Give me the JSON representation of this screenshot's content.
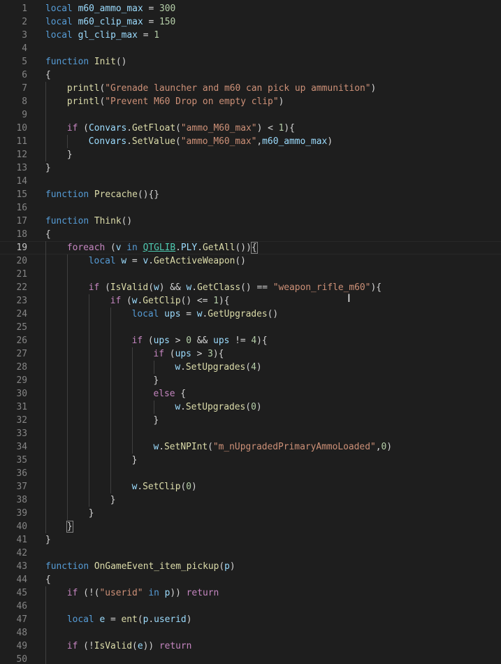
{
  "editor": {
    "colors": {
      "background": "#1e1e1e",
      "keyword": "#569cd6",
      "control": "#c586c0",
      "function": "#dcdcaa",
      "variable": "#9cdcfe",
      "string": "#ce9178",
      "number": "#b5cea8",
      "type": "#4ec9b0",
      "line_number": "#858585"
    },
    "active_line": 19,
    "mouse_cursor_icon": "text-ibeam-icon",
    "mouse_cursor_glyph": "I",
    "lines": [
      {
        "number": "1",
        "indent": 0,
        "tokens": [
          {
            "t": "local",
            "c": "kw"
          },
          {
            "t": " ",
            "c": "plain"
          },
          {
            "t": "m60_ammo_max",
            "c": "var"
          },
          {
            "t": " = ",
            "c": "op"
          },
          {
            "t": "300",
            "c": "num"
          }
        ]
      },
      {
        "number": "2",
        "indent": 0,
        "tokens": [
          {
            "t": "local",
            "c": "kw"
          },
          {
            "t": " ",
            "c": "plain"
          },
          {
            "t": "m60_clip_max",
            "c": "var"
          },
          {
            "t": " = ",
            "c": "op"
          },
          {
            "t": "150",
            "c": "num"
          }
        ]
      },
      {
        "number": "3",
        "indent": 0,
        "tokens": [
          {
            "t": "local",
            "c": "kw"
          },
          {
            "t": " ",
            "c": "plain"
          },
          {
            "t": "gl_clip_max",
            "c": "var"
          },
          {
            "t": " = ",
            "c": "op"
          },
          {
            "t": "1",
            "c": "num"
          }
        ]
      },
      {
        "number": "4",
        "indent": 0,
        "tokens": []
      },
      {
        "number": "5",
        "indent": 0,
        "tokens": [
          {
            "t": "function",
            "c": "kw"
          },
          {
            "t": " ",
            "c": "plain"
          },
          {
            "t": "Init",
            "c": "fn"
          },
          {
            "t": "()",
            "c": "plain"
          }
        ]
      },
      {
        "number": "6",
        "indent": 0,
        "tokens": [
          {
            "t": "{",
            "c": "plain"
          }
        ]
      },
      {
        "number": "7",
        "indent": 1,
        "tokens": [
          {
            "t": "printl",
            "c": "fn"
          },
          {
            "t": "(",
            "c": "plain"
          },
          {
            "t": "\"Grenade launcher and m60 can pick up ammunition\"",
            "c": "str"
          },
          {
            "t": ")",
            "c": "plain"
          }
        ]
      },
      {
        "number": "8",
        "indent": 1,
        "tokens": [
          {
            "t": "printl",
            "c": "fn"
          },
          {
            "t": "(",
            "c": "plain"
          },
          {
            "t": "\"Prevent M60 Drop on empty clip\"",
            "c": "str"
          },
          {
            "t": ")",
            "c": "plain"
          }
        ]
      },
      {
        "number": "9",
        "indent": 1,
        "tokens": []
      },
      {
        "number": "10",
        "indent": 1,
        "tokens": [
          {
            "t": "if",
            "c": "ctrl"
          },
          {
            "t": " (",
            "c": "plain"
          },
          {
            "t": "Convars",
            "c": "var"
          },
          {
            "t": ".",
            "c": "plain"
          },
          {
            "t": "GetFloat",
            "c": "fn"
          },
          {
            "t": "(",
            "c": "plain"
          },
          {
            "t": "\"ammo_M60_max\"",
            "c": "str"
          },
          {
            "t": ") < ",
            "c": "op"
          },
          {
            "t": "1",
            "c": "num"
          },
          {
            "t": "){",
            "c": "plain"
          }
        ]
      },
      {
        "number": "11",
        "indent": 2,
        "tokens": [
          {
            "t": "Convars",
            "c": "var"
          },
          {
            "t": ".",
            "c": "plain"
          },
          {
            "t": "SetValue",
            "c": "fn"
          },
          {
            "t": "(",
            "c": "plain"
          },
          {
            "t": "\"ammo_M60_max\"",
            "c": "str"
          },
          {
            "t": ",",
            "c": "plain"
          },
          {
            "t": "m60_ammo_max",
            "c": "var"
          },
          {
            "t": ")",
            "c": "plain"
          }
        ]
      },
      {
        "number": "12",
        "indent": 1,
        "tokens": [
          {
            "t": "}",
            "c": "plain"
          }
        ]
      },
      {
        "number": "13",
        "indent": 0,
        "tokens": [
          {
            "t": "}",
            "c": "plain"
          }
        ]
      },
      {
        "number": "14",
        "indent": 0,
        "tokens": []
      },
      {
        "number": "15",
        "indent": 0,
        "tokens": [
          {
            "t": "function",
            "c": "kw"
          },
          {
            "t": " ",
            "c": "plain"
          },
          {
            "t": "Precache",
            "c": "fn"
          },
          {
            "t": "(){}",
            "c": "plain"
          }
        ]
      },
      {
        "number": "16",
        "indent": 0,
        "tokens": []
      },
      {
        "number": "17",
        "indent": 0,
        "tokens": [
          {
            "t": "function",
            "c": "kw"
          },
          {
            "t": " ",
            "c": "plain"
          },
          {
            "t": "Think",
            "c": "fn"
          },
          {
            "t": "()",
            "c": "plain"
          }
        ]
      },
      {
        "number": "18",
        "indent": 0,
        "tokens": [
          {
            "t": "{",
            "c": "plain"
          }
        ]
      },
      {
        "number": "19",
        "indent": 1,
        "tokens": [
          {
            "t": "foreach",
            "c": "ctrl"
          },
          {
            "t": " (",
            "c": "plain"
          },
          {
            "t": "v",
            "c": "var"
          },
          {
            "t": " in ",
            "c": "kw"
          },
          {
            "t": "QTGLIB",
            "c": "type",
            "u": true
          },
          {
            "t": ".",
            "c": "plain"
          },
          {
            "t": "PLY",
            "c": "var"
          },
          {
            "t": ".",
            "c": "plain"
          },
          {
            "t": "GetAll",
            "c": "fn"
          },
          {
            "t": "())",
            "c": "plain"
          },
          {
            "t": "{",
            "c": "plain",
            "b": true
          }
        ]
      },
      {
        "number": "20",
        "indent": 2,
        "tokens": [
          {
            "t": "local",
            "c": "kw"
          },
          {
            "t": " ",
            "c": "plain"
          },
          {
            "t": "w",
            "c": "var"
          },
          {
            "t": " = ",
            "c": "op"
          },
          {
            "t": "v",
            "c": "var"
          },
          {
            "t": ".",
            "c": "plain"
          },
          {
            "t": "GetActiveWeapon",
            "c": "fn"
          },
          {
            "t": "()",
            "c": "plain"
          }
        ]
      },
      {
        "number": "21",
        "indent": 2,
        "tokens": []
      },
      {
        "number": "22",
        "indent": 2,
        "tokens": [
          {
            "t": "if",
            "c": "ctrl"
          },
          {
            "t": " (",
            "c": "plain"
          },
          {
            "t": "IsValid",
            "c": "fn"
          },
          {
            "t": "(",
            "c": "plain"
          },
          {
            "t": "w",
            "c": "var"
          },
          {
            "t": ") && ",
            "c": "op"
          },
          {
            "t": "w",
            "c": "var"
          },
          {
            "t": ".",
            "c": "plain"
          },
          {
            "t": "GetClass",
            "c": "fn"
          },
          {
            "t": "() == ",
            "c": "op"
          },
          {
            "t": "\"weapon_rifle_m60\"",
            "c": "str"
          },
          {
            "t": "){",
            "c": "plain"
          }
        ]
      },
      {
        "number": "23",
        "indent": 3,
        "tokens": [
          {
            "t": "if",
            "c": "ctrl"
          },
          {
            "t": " (",
            "c": "plain"
          },
          {
            "t": "w",
            "c": "var"
          },
          {
            "t": ".",
            "c": "plain"
          },
          {
            "t": "GetClip",
            "c": "fn"
          },
          {
            "t": "() <= ",
            "c": "op"
          },
          {
            "t": "1",
            "c": "num"
          },
          {
            "t": "){",
            "c": "plain"
          }
        ]
      },
      {
        "number": "24",
        "indent": 4,
        "tokens": [
          {
            "t": "local",
            "c": "kw"
          },
          {
            "t": " ",
            "c": "plain"
          },
          {
            "t": "ups",
            "c": "var"
          },
          {
            "t": " = ",
            "c": "op"
          },
          {
            "t": "w",
            "c": "var"
          },
          {
            "t": ".",
            "c": "plain"
          },
          {
            "t": "GetUpgrades",
            "c": "fn"
          },
          {
            "t": "()",
            "c": "plain"
          }
        ]
      },
      {
        "number": "25",
        "indent": 4,
        "tokens": []
      },
      {
        "number": "26",
        "indent": 4,
        "tokens": [
          {
            "t": "if",
            "c": "ctrl"
          },
          {
            "t": " (",
            "c": "plain"
          },
          {
            "t": "ups",
            "c": "var"
          },
          {
            "t": " > ",
            "c": "op"
          },
          {
            "t": "0",
            "c": "num"
          },
          {
            "t": " && ",
            "c": "op"
          },
          {
            "t": "ups",
            "c": "var"
          },
          {
            "t": " != ",
            "c": "op"
          },
          {
            "t": "4",
            "c": "num"
          },
          {
            "t": "){",
            "c": "plain"
          }
        ]
      },
      {
        "number": "27",
        "indent": 5,
        "tokens": [
          {
            "t": "if",
            "c": "ctrl"
          },
          {
            "t": " (",
            "c": "plain"
          },
          {
            "t": "ups",
            "c": "var"
          },
          {
            "t": " > ",
            "c": "op"
          },
          {
            "t": "3",
            "c": "num"
          },
          {
            "t": "){",
            "c": "plain"
          }
        ]
      },
      {
        "number": "28",
        "indent": 6,
        "tokens": [
          {
            "t": "w",
            "c": "var"
          },
          {
            "t": ".",
            "c": "plain"
          },
          {
            "t": "SetUpgrades",
            "c": "fn"
          },
          {
            "t": "(",
            "c": "plain"
          },
          {
            "t": "4",
            "c": "num"
          },
          {
            "t": ")",
            "c": "plain"
          }
        ]
      },
      {
        "number": "29",
        "indent": 5,
        "tokens": [
          {
            "t": "}",
            "c": "plain"
          }
        ]
      },
      {
        "number": "30",
        "indent": 5,
        "tokens": [
          {
            "t": "else",
            "c": "ctrl"
          },
          {
            "t": " {",
            "c": "plain"
          }
        ]
      },
      {
        "number": "31",
        "indent": 6,
        "tokens": [
          {
            "t": "w",
            "c": "var"
          },
          {
            "t": ".",
            "c": "plain"
          },
          {
            "t": "SetUpgrades",
            "c": "fn"
          },
          {
            "t": "(",
            "c": "plain"
          },
          {
            "t": "0",
            "c": "num"
          },
          {
            "t": ")",
            "c": "plain"
          }
        ]
      },
      {
        "number": "32",
        "indent": 5,
        "tokens": [
          {
            "t": "}",
            "c": "plain"
          }
        ]
      },
      {
        "number": "33",
        "indent": 5,
        "tokens": []
      },
      {
        "number": "34",
        "indent": 5,
        "tokens": [
          {
            "t": "w",
            "c": "var"
          },
          {
            "t": ".",
            "c": "plain"
          },
          {
            "t": "SetNPInt",
            "c": "fn"
          },
          {
            "t": "(",
            "c": "plain"
          },
          {
            "t": "\"m_nUpgradedPrimaryAmmoLoaded\"",
            "c": "str"
          },
          {
            "t": ",",
            "c": "plain"
          },
          {
            "t": "0",
            "c": "num"
          },
          {
            "t": ")",
            "c": "plain"
          }
        ]
      },
      {
        "number": "35",
        "indent": 4,
        "tokens": [
          {
            "t": "}",
            "c": "plain"
          }
        ]
      },
      {
        "number": "36",
        "indent": 4,
        "tokens": []
      },
      {
        "number": "37",
        "indent": 4,
        "tokens": [
          {
            "t": "w",
            "c": "var"
          },
          {
            "t": ".",
            "c": "plain"
          },
          {
            "t": "SetClip",
            "c": "fn"
          },
          {
            "t": "(",
            "c": "plain"
          },
          {
            "t": "0",
            "c": "num"
          },
          {
            "t": ")",
            "c": "plain"
          }
        ]
      },
      {
        "number": "38",
        "indent": 3,
        "tokens": [
          {
            "t": "}",
            "c": "plain"
          }
        ]
      },
      {
        "number": "39",
        "indent": 2,
        "tokens": [
          {
            "t": "}",
            "c": "plain"
          }
        ]
      },
      {
        "number": "40",
        "indent": 1,
        "tokens": [
          {
            "t": "}",
            "c": "plain",
            "b": true
          }
        ]
      },
      {
        "number": "41",
        "indent": 0,
        "tokens": [
          {
            "t": "}",
            "c": "plain"
          }
        ]
      },
      {
        "number": "42",
        "indent": 0,
        "tokens": []
      },
      {
        "number": "43",
        "indent": 0,
        "tokens": [
          {
            "t": "function",
            "c": "kw"
          },
          {
            "t": " ",
            "c": "plain"
          },
          {
            "t": "OnGameEvent_item_pickup",
            "c": "fn"
          },
          {
            "t": "(",
            "c": "plain"
          },
          {
            "t": "p",
            "c": "var"
          },
          {
            "t": ")",
            "c": "plain"
          }
        ]
      },
      {
        "number": "44",
        "indent": 0,
        "tokens": [
          {
            "t": "{",
            "c": "plain"
          }
        ]
      },
      {
        "number": "45",
        "indent": 1,
        "tokens": [
          {
            "t": "if",
            "c": "ctrl"
          },
          {
            "t": " (!(",
            "c": "plain"
          },
          {
            "t": "\"userid\"",
            "c": "str"
          },
          {
            "t": " in ",
            "c": "kw"
          },
          {
            "t": "p",
            "c": "var"
          },
          {
            "t": ")) ",
            "c": "plain"
          },
          {
            "t": "return",
            "c": "ctrl"
          }
        ]
      },
      {
        "number": "46",
        "indent": 1,
        "tokens": []
      },
      {
        "number": "47",
        "indent": 1,
        "tokens": [
          {
            "t": "local",
            "c": "kw"
          },
          {
            "t": " ",
            "c": "plain"
          },
          {
            "t": "e",
            "c": "var"
          },
          {
            "t": " = ",
            "c": "op"
          },
          {
            "t": "ent",
            "c": "fn"
          },
          {
            "t": "(",
            "c": "plain"
          },
          {
            "t": "p",
            "c": "var"
          },
          {
            "t": ".",
            "c": "plain"
          },
          {
            "t": "userid",
            "c": "var"
          },
          {
            "t": ")",
            "c": "plain"
          }
        ]
      },
      {
        "number": "48",
        "indent": 1,
        "tokens": []
      },
      {
        "number": "49",
        "indent": 1,
        "tokens": [
          {
            "t": "if",
            "c": "ctrl"
          },
          {
            "t": " (!",
            "c": "plain"
          },
          {
            "t": "IsValid",
            "c": "fn"
          },
          {
            "t": "(",
            "c": "plain"
          },
          {
            "t": "e",
            "c": "var"
          },
          {
            "t": ")) ",
            "c": "plain"
          },
          {
            "t": "return",
            "c": "ctrl"
          }
        ]
      },
      {
        "number": "50",
        "indent": 1,
        "tokens": []
      }
    ]
  }
}
